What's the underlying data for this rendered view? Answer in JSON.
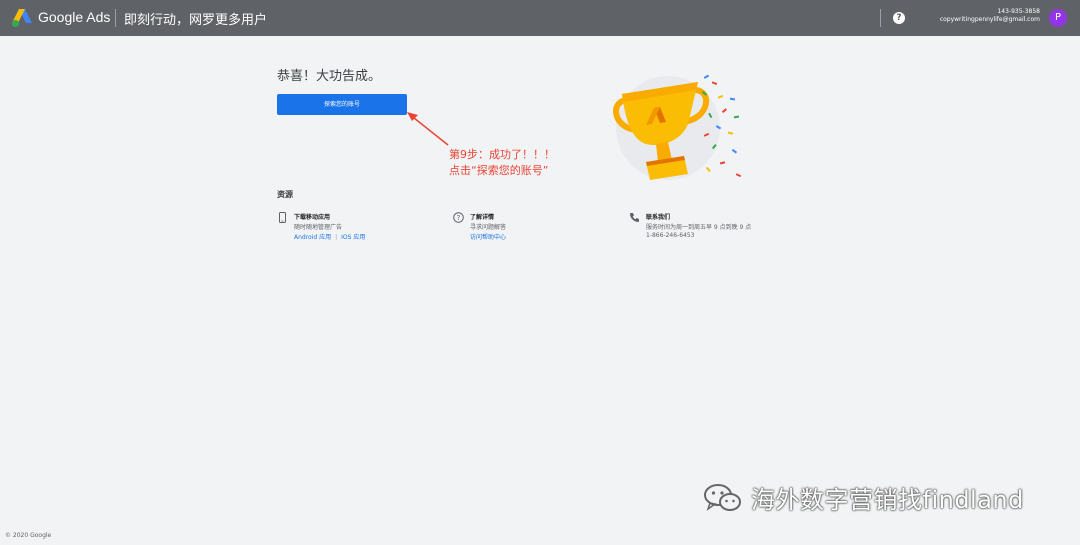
{
  "header": {
    "brand": "Google Ads",
    "tagline": "即刻行动，网罗更多用户",
    "help_icon": "help-circle-icon",
    "account_id": "143-935-3858",
    "account_email": "copywritingpennylife@gmail.com",
    "avatar_letter": "P",
    "avatar_color": "#9334e6"
  },
  "main": {
    "headline": "恭喜！大功告成。",
    "explore_button": "探索您的账号",
    "annotation": {
      "line1": "第9步：成功了！！！",
      "line2": "点击“探索您的账号”",
      "color": "#ea4335"
    },
    "illustration": "trophy-confetti"
  },
  "resources": {
    "title": "资源",
    "items": [
      {
        "icon": "mobile-phone-icon",
        "title": "下载移动应用",
        "desc": "随时随地管理广告",
        "link_android": "Android 应用",
        "link_ios": "IOS 应用",
        "separator": "|"
      },
      {
        "icon": "help-circle-icon",
        "title": "了解详情",
        "desc": "寻求问题解答",
        "link": "访问帮助中心"
      },
      {
        "icon": "phone-icon",
        "title": "联系我们",
        "desc": "服务时间为周一到周五早 9 点到晚 9 点",
        "phone": "1-866-246-6453"
      }
    ]
  },
  "footer": {
    "copyright": "© 2020 Google"
  },
  "watermark": {
    "icon": "wechat-icon",
    "text": "海外数字营销找findland"
  },
  "colors": {
    "topbar": "#5f6368",
    "primary": "#1a73e8",
    "background": "#f1f3f4"
  }
}
